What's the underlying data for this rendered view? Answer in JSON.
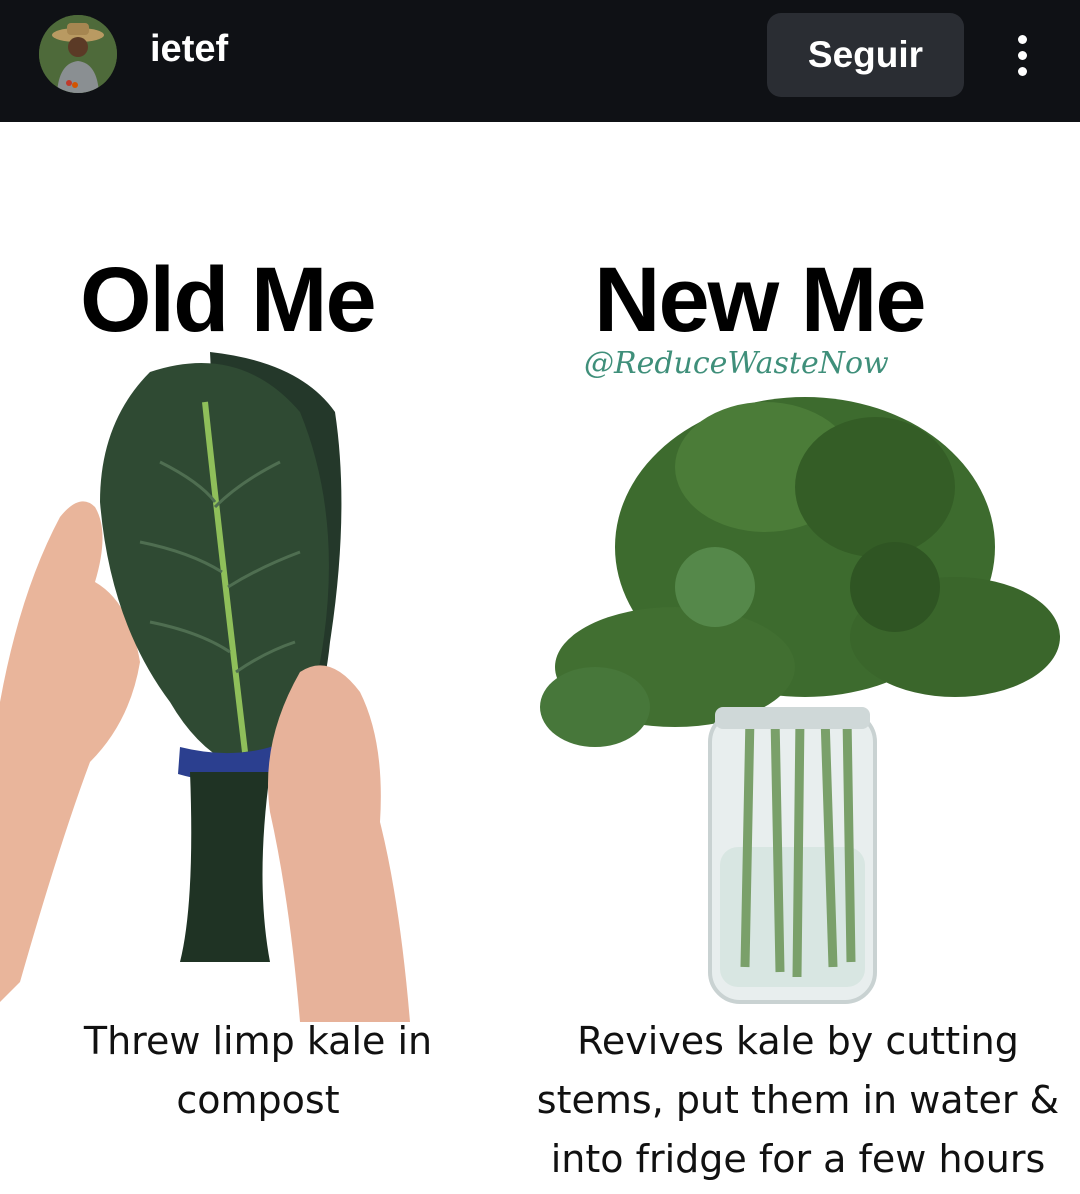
{
  "header": {
    "username": "ietef",
    "follow_label": "Seguir"
  },
  "post": {
    "left": {
      "title": "Old Me",
      "caption": "Threw limp kale in compost"
    },
    "right": {
      "title": "New Me",
      "handle": "@ReduceWasteNow",
      "caption": "Revives kale by cutting stems, put them in water & into fridge for a few hours"
    }
  },
  "colors": {
    "topbar": "#0f1115",
    "follow_button": "#2a2d33",
    "handle_text": "#3f8f7a",
    "kale_dark": "#2f4a33",
    "kale_curly": "#3d6b2e"
  },
  "icons": {
    "more": "more-vertical-icon"
  }
}
